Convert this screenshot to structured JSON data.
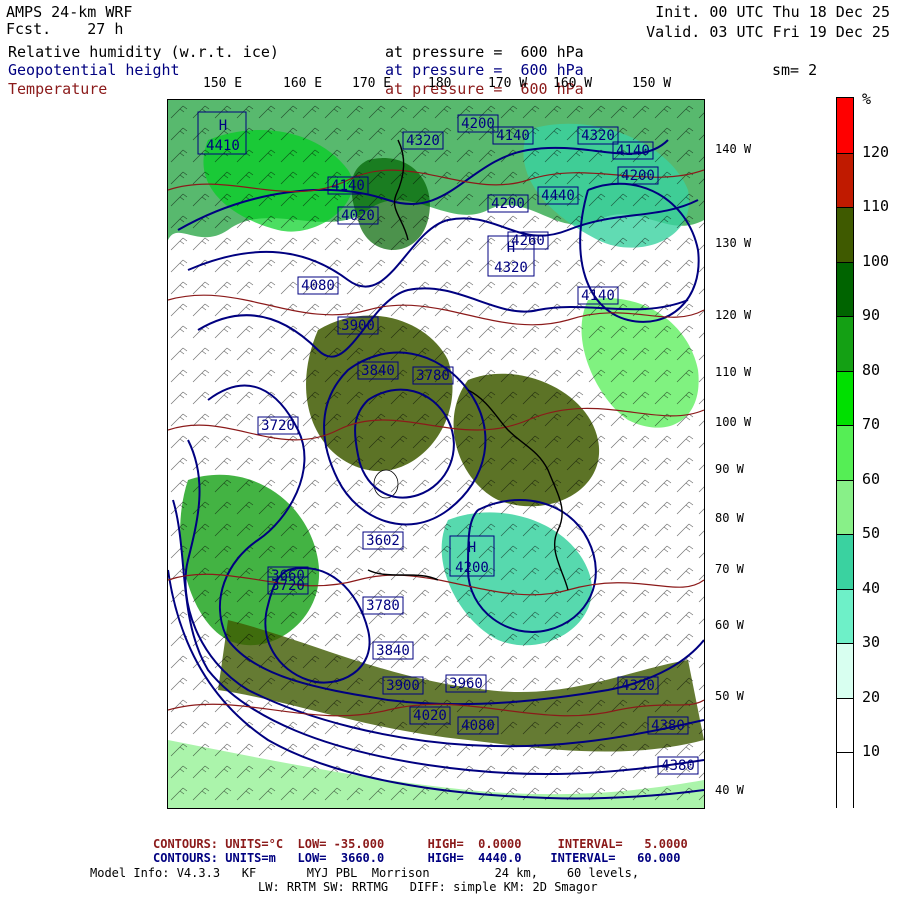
{
  "header": {
    "model": "AMPS 24-km WRF",
    "fcst_label": "Fcst.",
    "fcst_value": "27 h",
    "init": "Init. 00 UTC Thu 18 Dec 25",
    "valid": "Valid. 03 UTC Fri 19 Dec 25",
    "fields": [
      {
        "name": "Relative humidity (w.r.t. ice)",
        "level": "at pressure =  600 hPa",
        "color": "#000000"
      },
      {
        "name": "Geopotential height",
        "level": "at pressure =  600 hPa",
        "color": "#000080"
      },
      {
        "name": "Temperature",
        "level": "at pressure =  600 hPa",
        "color": "#8b1a1a"
      }
    ],
    "smoothing": "sm= 2"
  },
  "longitudes_top": [
    "150 E",
    "160 E",
    "170 E",
    "180",
    "170 W",
    "160 W",
    "150 W"
  ],
  "longitudes_right": [
    "140 W",
    "130 W",
    "120 W",
    "110 W",
    "100 W",
    "90 W",
    "80 W",
    "70 W",
    "60 W",
    "50 W",
    "40 W"
  ],
  "colorbar": {
    "unit": "%",
    "labels": [
      "120",
      "110",
      "100",
      "90",
      "80",
      "70",
      "60",
      "50",
      "40",
      "30",
      "20",
      "10"
    ],
    "colors": [
      "#ff0000",
      "#c01a00",
      "#3f5a00",
      "#006400",
      "#14a014",
      "#00e000",
      "#55ee55",
      "#88f088",
      "#3ad2a0",
      "#6ef0c8",
      "#d8fff0",
      "#ffffff",
      "#ffffff"
    ]
  },
  "map_labels": {
    "highs": [
      "H",
      "H",
      "H"
    ],
    "height_labels": [
      "4410",
      "4320",
      "4200",
      "4140",
      "4020",
      "4080",
      "3900",
      "3840",
      "3780",
      "3720",
      "3660",
      "3602",
      "3720",
      "3780",
      "3840",
      "3900",
      "3960",
      "4020",
      "4080",
      "4140",
      "4200",
      "4260",
      "4320",
      "4380",
      "4440",
      "4200",
      "4140",
      "4380",
      "4320",
      "4140"
    ],
    "colors": {
      "height": "#000080",
      "temperature": "#8b1a1a",
      "wind": "#000000"
    }
  },
  "footer": {
    "temp_contours": {
      "label": "CONTOURS:",
      "units": "UNITS=°C",
      "low": "LOW= -35.000",
      "high": "HIGH=  0.0000",
      "interval": "INTERVAL=   5.0000"
    },
    "height_contours": {
      "label": "CONTOURS:",
      "units": "UNITS=m",
      "low": "LOW=  3660.0",
      "high": "HIGH=  4440.0",
      "interval": "INTERVAL=   60.000"
    },
    "model_info_1": "Model Info: V4.3.3   KF       MYJ PBL  Morrison         24 km,    60 levels,",
    "model_info_2": "LW: RRTM SW: RRTMG   DIFF: simple KM: 2D Smagor"
  }
}
